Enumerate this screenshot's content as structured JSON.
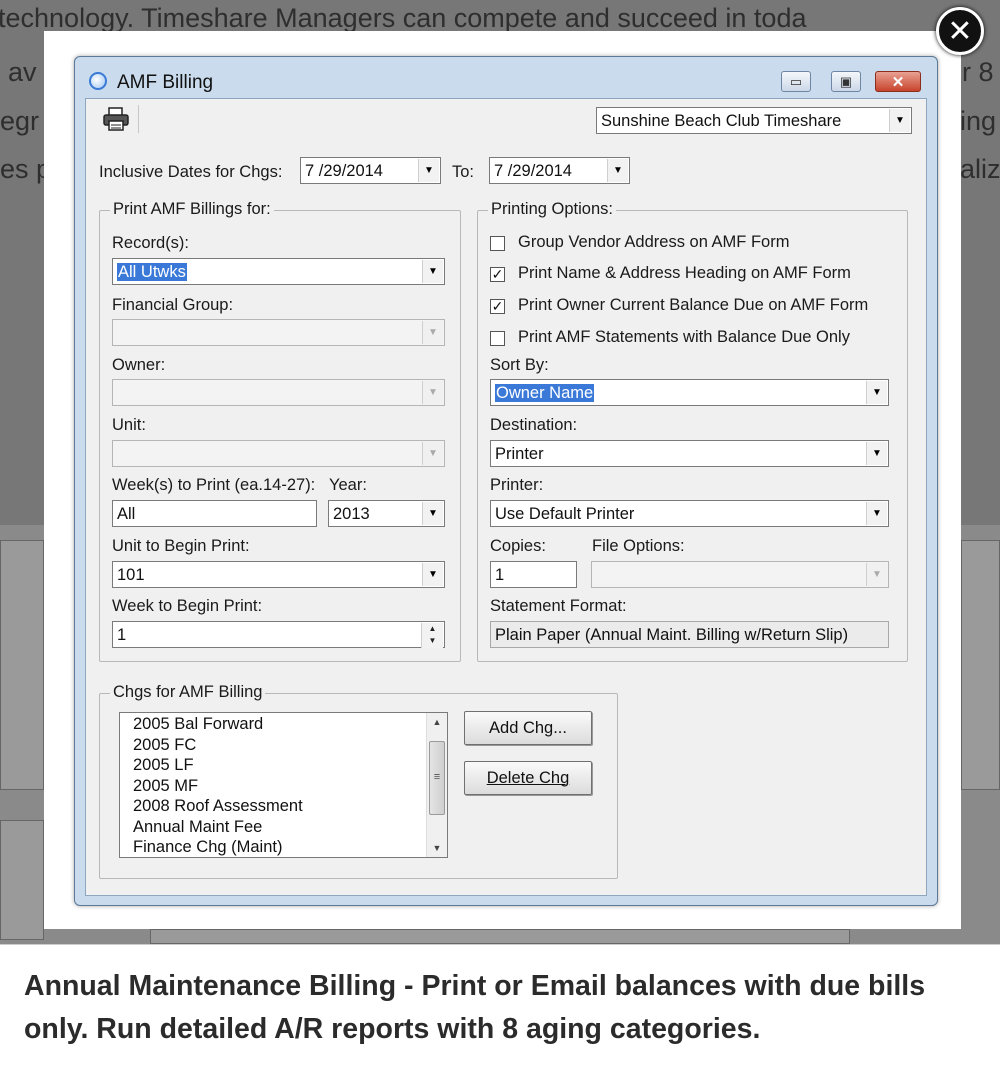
{
  "background": {
    "lines": [
      "technology. Timeshare Managers can compete and succeed in toda",
      "av",
      "egr",
      "es p"
    ],
    "right_fragments": [
      "r 8",
      "ing",
      "aliz"
    ]
  },
  "window": {
    "title": "AMF Billing",
    "minimize_glyph": "▭",
    "restore_glyph": "▣",
    "close_glyph": "✕"
  },
  "toolbar": {
    "property_select": "Sunshine Beach Club Timeshare"
  },
  "dates": {
    "label": "Inclusive Dates for Chgs:",
    "from": "7 /29/2014",
    "to_label": "To:",
    "to": "7 /29/2014"
  },
  "print_for": {
    "group_label": "Print AMF Billings for:",
    "records_label": "Record(s):",
    "records_value": "All Utwks",
    "financial_group_label": "Financial Group:",
    "owner_label": "Owner:",
    "unit_label": "Unit:",
    "weeks_label": "Week(s) to Print (ea.14-27):",
    "weeks_value": "All",
    "year_label": "Year:",
    "year_value": "2013",
    "unit_begin_label": "Unit to Begin Print:",
    "unit_begin_value": "101",
    "week_begin_label": "Week to Begin Print:",
    "week_begin_value": "1"
  },
  "printing_options": {
    "group_label": "Printing Options:",
    "checkboxes": [
      {
        "label": "Group Vendor Address on AMF Form",
        "checked": false,
        "mark": ""
      },
      {
        "label": "Print Name & Address Heading on AMF Form",
        "checked": true,
        "mark": "✓"
      },
      {
        "label": "Print Owner Current Balance Due on AMF Form",
        "checked": true,
        "mark": "✓"
      },
      {
        "label": "Print AMF Statements with Balance Due Only",
        "checked": false,
        "mark": ""
      }
    ],
    "sort_by_label": "Sort By:",
    "sort_by_value": "Owner Name",
    "destination_label": "Destination:",
    "destination_value": "Printer",
    "printer_label": "Printer:",
    "printer_value": "Use Default Printer",
    "copies_label": "Copies:",
    "copies_value": "1",
    "file_options_label": "File Options:",
    "statement_format_label": "Statement Format:",
    "statement_format_value": "Plain Paper (Annual Maint. Billing w/Return Slip)"
  },
  "charges": {
    "group_label": "Chgs for AMF Billing",
    "items": [
      "2005 Bal Forward",
      "2005 FC",
      "2005 LF",
      "2005 MF",
      "2008 Roof Assessment",
      "Annual Maint Fee",
      "Finance Chg (Maint)"
    ],
    "add_button": "Add Chg...",
    "delete_button": "Delete Chg"
  },
  "icons": {
    "print": "printer-icon",
    "dropdown": "▼",
    "close_lightbox": "✕",
    "scroll_up": "▲",
    "scroll_down": "▼",
    "scroll_grip": "≡"
  },
  "lightbox": {
    "close_glyph": "✕",
    "caption": "Annual Maintenance Billing - Print or Email balances with due bills only. Run detailed A/R reports with 8 aging categories."
  }
}
